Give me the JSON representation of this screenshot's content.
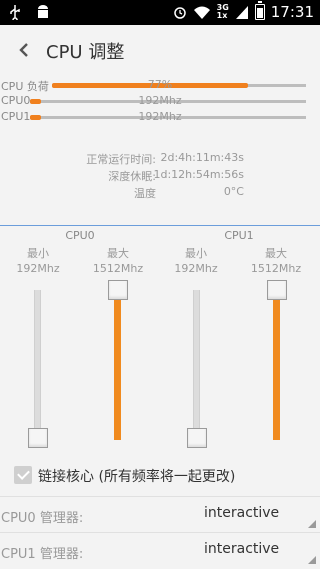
{
  "status_bar": {
    "time": "17:31",
    "network_top": "3G",
    "network_bottom": "1x",
    "icons": [
      "usb-icon",
      "android-debug-icon",
      "alarm-icon",
      "wifi-icon",
      "signal-icon",
      "battery-icon"
    ]
  },
  "header": {
    "title": "CPU 调整"
  },
  "load": {
    "rows": [
      {
        "label": "CPU 负荷",
        "value": "77%",
        "fraction": 0.77
      },
      {
        "label": "CPU0",
        "value": "192Mhz",
        "fraction": 0.04
      },
      {
        "label": "CPU1",
        "value": "192Mhz",
        "fraction": 0.04
      }
    ]
  },
  "info": [
    {
      "key": "正常运行时间:",
      "value": "2d:4h:11m:43s"
    },
    {
      "key": "深度休眠:",
      "value": "1d:12h:54m:56s"
    },
    {
      "key": "温度",
      "value": "0°C"
    }
  ],
  "cpus": [
    {
      "name": "CPU0",
      "min_label": "最小",
      "min_value": "192Mhz",
      "min_level": 0.0,
      "max_label": "最大",
      "max_value": "1512Mhz",
      "max_level": 1.0
    },
    {
      "name": "CPU1",
      "min_label": "最小",
      "min_value": "192Mhz",
      "min_level": 0.0,
      "max_label": "最大",
      "max_value": "1512Mhz",
      "max_level": 1.0
    }
  ],
  "link_cores": {
    "label": "链接核心 (所有频率将一起更改)",
    "checked": true
  },
  "governors": [
    {
      "label": "CPU0 管理器:",
      "value": "interactive"
    },
    {
      "label": "CPU1 管理器:",
      "value": "interactive"
    }
  ],
  "colors": {
    "accent": "#f0801e",
    "divider": "#6b9ddb"
  }
}
